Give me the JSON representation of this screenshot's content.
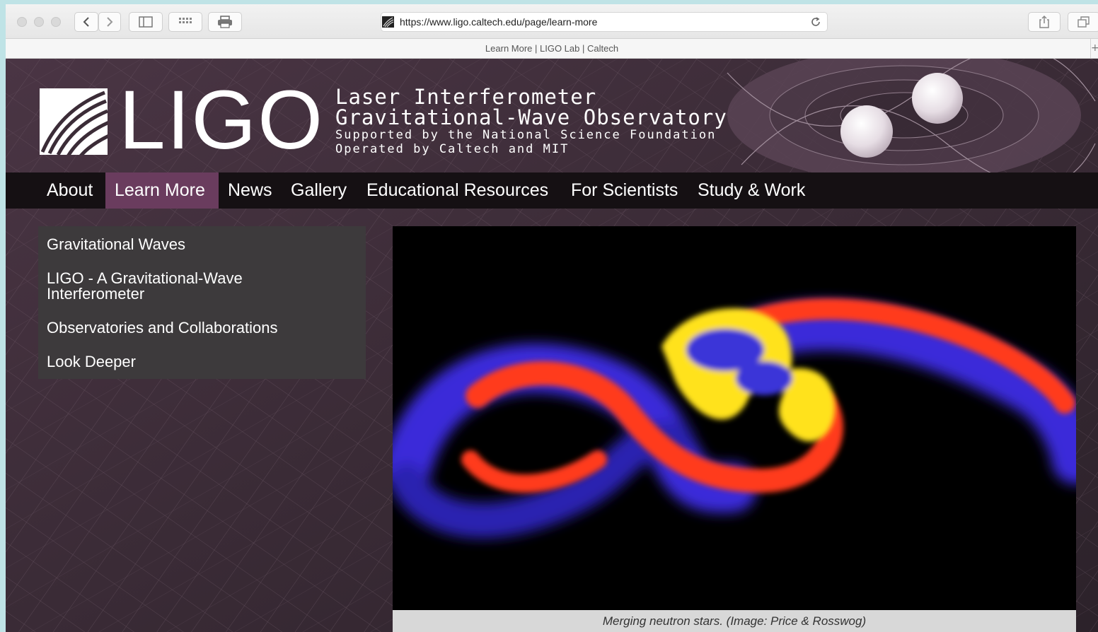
{
  "browser": {
    "url": "https://www.ligo.caltech.edu/page/learn-more",
    "tab_title": "Learn More | LIGO Lab | Caltech",
    "new_tab": "+",
    "buttons": [
      "back-icon",
      "forward-icon",
      "sidebar-icon",
      "top-sites-icon",
      "print-icon",
      "reload-icon",
      "share-icon",
      "tabs-overview-icon"
    ]
  },
  "header": {
    "logo_word": "LIGO",
    "tagline_1": "Laser Interferometer",
    "tagline_2": "Gravitational-Wave Observatory",
    "tagline_3": "Supported by the National Science Foundation",
    "tagline_4": "Operated by Caltech and MIT"
  },
  "nav": {
    "items": [
      {
        "label": "About",
        "active": false
      },
      {
        "label": "Learn More",
        "active": true
      },
      {
        "label": "News",
        "active": false
      },
      {
        "label": "Gallery",
        "active": false
      },
      {
        "label": "Educational Resources",
        "active": false
      },
      {
        "label": "For Scientists",
        "active": false
      },
      {
        "label": "Study & Work",
        "active": false
      }
    ]
  },
  "sidebar": {
    "items": [
      {
        "label": "Gravitational Waves"
      },
      {
        "label_line1": "LIGO - A Gravitational-Wave",
        "label_line2": "Interferometer"
      },
      {
        "label": "Observatories and Collaborations"
      },
      {
        "label": "Look Deeper"
      }
    ]
  },
  "figure": {
    "caption": "Merging neutron stars. (Image: Price & Rosswog)"
  },
  "colors": {
    "nav_active": "#6a3c5e",
    "nav_bg": "#151013",
    "page_bg": "#3b2c37",
    "caption_bg": "#d8d8d8"
  }
}
